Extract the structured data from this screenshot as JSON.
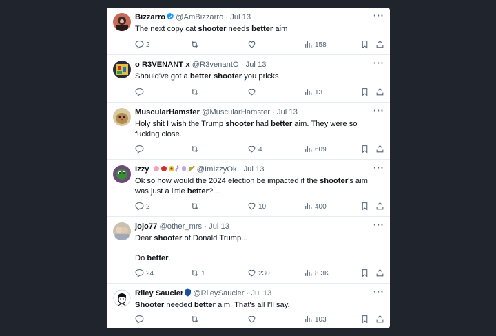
{
  "tweets": [
    {
      "name": "Bizzarro",
      "verified": true,
      "handle": "@AmBizzarro",
      "date": "Jul 13",
      "body": [
        [
          "The next copy cat ",
          false
        ],
        [
          "shooter",
          true
        ],
        [
          " needs ",
          false
        ],
        [
          "better",
          true
        ],
        [
          " aim",
          false
        ]
      ],
      "replies": "2",
      "retweets": "",
      "likes": "",
      "views": "158"
    },
    {
      "name": "o R3VENANT x",
      "verified": false,
      "handle": "@R3venantO",
      "date": "Jul 13",
      "body": [
        [
          "Should've got a ",
          false
        ],
        [
          "better shooter",
          true
        ],
        [
          " you pricks",
          false
        ]
      ],
      "replies": "",
      "retweets": "",
      "likes": "",
      "views": "13"
    },
    {
      "name": "MuscularHamster",
      "verified": false,
      "handle": "@MuscularHamster",
      "date": "Jul 13",
      "body": [
        [
          "Holy shit I wish the Trump ",
          false
        ],
        [
          "shooter",
          true
        ],
        [
          " had ",
          false
        ],
        [
          "better",
          true
        ],
        [
          " aim. They were so fucking close.",
          false
        ]
      ],
      "replies": "",
      "retweets": "",
      "likes": "4",
      "views": "609"
    },
    {
      "name": "Izzy",
      "verified": false,
      "emojis": true,
      "handle": "@ImIzzyOk",
      "date": "Jul 13",
      "body": [
        [
          "Ok so how would the 2024 election be impacted if the ",
          false
        ],
        [
          "shooter",
          true
        ],
        [
          "'s aim was just a little ",
          false
        ],
        [
          "better",
          true
        ],
        [
          "?...",
          false
        ]
      ],
      "replies": "2",
      "retweets": "",
      "likes": "10",
      "views": "400"
    },
    {
      "name": "jojo77",
      "verified": false,
      "handle": "@other_mrs",
      "date": "Jul 13",
      "body": [
        [
          "Dear ",
          false
        ],
        [
          "shooter",
          true
        ],
        [
          " of Donald Trump...",
          false
        ],
        [
          "\n\nDo ",
          false
        ],
        [
          "better",
          true
        ],
        [
          ".",
          false
        ]
      ],
      "replies": "24",
      "retweets": "1",
      "likes": "230",
      "views": "8.3K"
    },
    {
      "name": "Riley Saucier",
      "verified": false,
      "shield": true,
      "handle": "@RileySaucier",
      "date": "Jul 13",
      "body": [
        [
          "Shooter",
          true
        ],
        [
          " needed ",
          false
        ],
        [
          "better",
          true
        ],
        [
          " aim. That's all I'll say.",
          false
        ]
      ],
      "replies": "",
      "retweets": "",
      "likes": "",
      "views": "103"
    }
  ],
  "ui": {
    "dot": "·",
    "more": "···"
  },
  "colors": {
    "verified": "#1d9bf0",
    "text": "#0f1419",
    "muted": "#536471",
    "background": "#1f242d"
  }
}
